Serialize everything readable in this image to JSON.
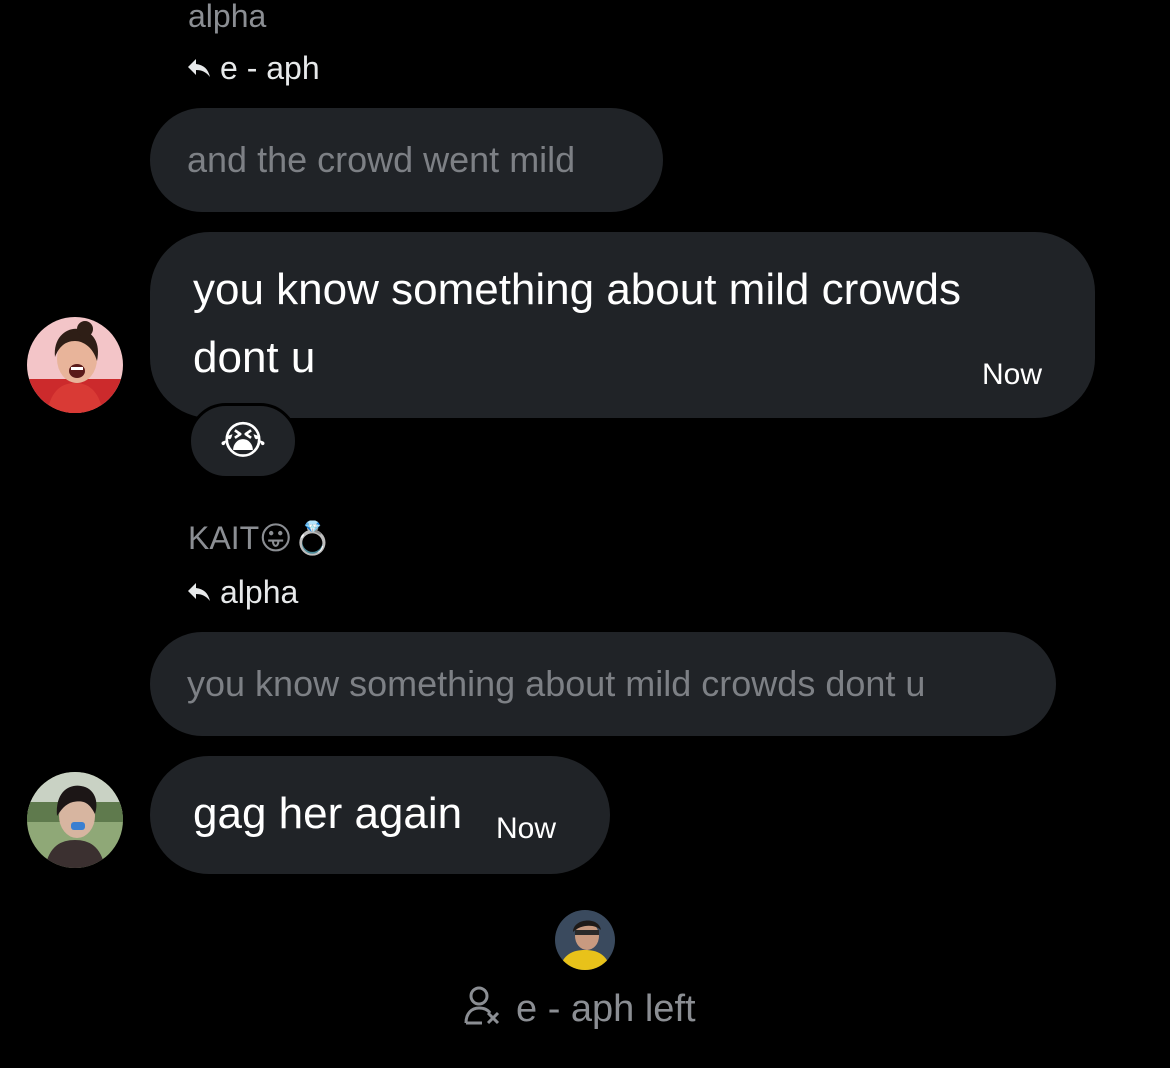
{
  "thread": {
    "message1": {
      "sender": "alpha",
      "reply_to": "e - aph",
      "quoted_text": "and the crowd went mild",
      "text": "you know something about mild crowds dont u",
      "time": "Now",
      "reaction": "😭"
    },
    "message2": {
      "sender": "KAIT😛💍",
      "reply_to": "alpha",
      "quoted_text": "you know something about mild crowds dont u",
      "text": "gag her again",
      "time": "Now"
    },
    "system_notice": {
      "text": "e - aph left"
    }
  },
  "colors": {
    "background": "#000000",
    "bubble": "#202327",
    "muted_text": "#8b8e93",
    "quoted_text": "#7d8085",
    "primary_text": "#ffffff"
  },
  "icons": {
    "reply": "reply-arrow-icon",
    "user_left": "user-remove-icon"
  }
}
